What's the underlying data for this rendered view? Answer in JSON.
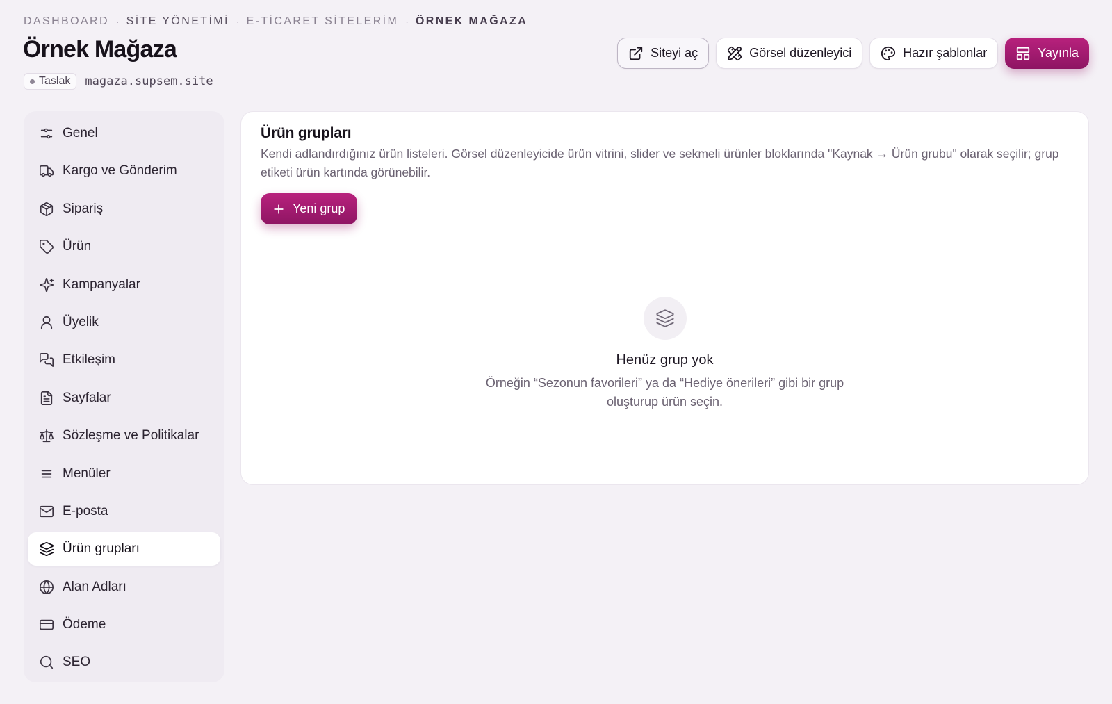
{
  "breadcrumb": [
    "DASHBOARD",
    "SİTE YÖNETİMİ",
    "E-TİCARET SİTELERİM",
    "ÖRNEK MAĞAZA"
  ],
  "page": {
    "title": "Örnek Mağaza",
    "status_badge": "Taslak",
    "domain": "magaza.supsem.site"
  },
  "header_actions": {
    "open_site": "Siteyi aç",
    "visual_editor": "Görsel düzenleyici",
    "templates": "Hazır şablonlar",
    "publish": "Yayınla"
  },
  "sidebar": {
    "active": "Ürün grupları",
    "items": [
      {
        "label": "Genel",
        "icon": "sliders-icon"
      },
      {
        "label": "Kargo ve Gönderim",
        "icon": "truck-icon"
      },
      {
        "label": "Sipariş",
        "icon": "package-icon"
      },
      {
        "label": "Ürün",
        "icon": "tag-icon"
      },
      {
        "label": "Kampanyalar",
        "icon": "sparkles-icon"
      },
      {
        "label": "Üyelik",
        "icon": "user-icon"
      },
      {
        "label": "Etkileşim",
        "icon": "messages-icon"
      },
      {
        "label": "Sayfalar",
        "icon": "file-icon"
      },
      {
        "label": "Sözleşme ve Politikalar",
        "icon": "scale-icon"
      },
      {
        "label": "Menüler",
        "icon": "menu-icon"
      },
      {
        "label": "E-posta",
        "icon": "mail-icon"
      },
      {
        "label": "Ürün grupları",
        "icon": "layers-icon"
      },
      {
        "label": "Alan Adları",
        "icon": "globe-icon"
      },
      {
        "label": "Ödeme",
        "icon": "credit-card-icon"
      },
      {
        "label": "SEO",
        "icon": "search-icon"
      }
    ]
  },
  "main": {
    "title": "Ürün grupları",
    "description": "Kendi adlandırdığınız ürün listeleri. Görsel düzenleyicide ürün vitrini, slider ve sekmeli ürünler bloklarında \"Kaynak → Ürün grubu\" olarak seçilir; grup etiketi ürün kartında görünebilir.",
    "new_button": "Yeni grup",
    "empty_title": "Henüz grup yok",
    "empty_description": "Örneğin “Sezonun favorileri” ya da “Hediye önerileri” gibi bir grup oluşturup ürün seçin."
  },
  "colors": {
    "accent": "#a81b73",
    "background": "#f4f1f6",
    "sidebar": "#efebf2"
  }
}
